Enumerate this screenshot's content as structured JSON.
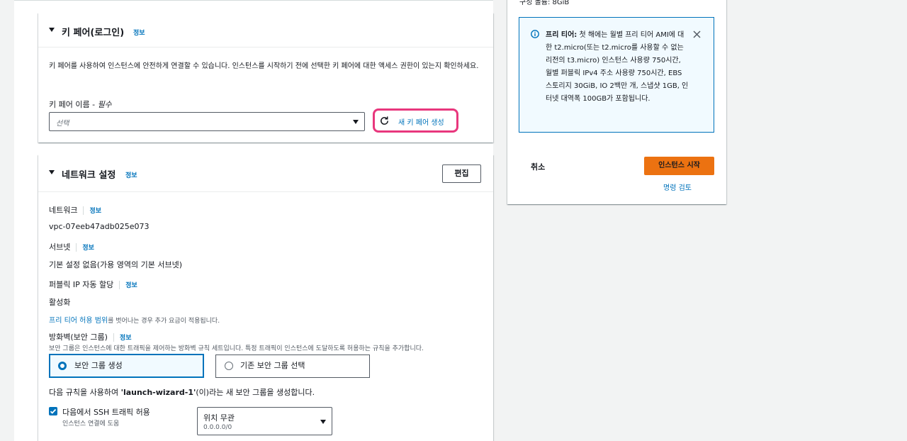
{
  "keypair": {
    "title": "키 페어(로그인)",
    "info": "정보",
    "description": "키 페어를 사용하여 인스턴스에 안전하게 연결할 수 있습니다. 인스턴스를 시작하기 전에 선택한 키 페어에 대한 액세스 권한이 있는지 확인하세요.",
    "field_label": "키 페어 이름 - ",
    "field_required": "필수",
    "select_placeholder": "선택",
    "create_button": "새 키 페어 생성"
  },
  "network": {
    "title": "네트워크 설정",
    "info": "정보",
    "edit_button": "편집",
    "network_label": "네트워크",
    "network_info": "정보",
    "network_value": "vpc-07eeb47adb025e073",
    "subnet_label": "서브넷",
    "subnet_info": "정보",
    "subnet_value": "기본 설정 없음(가용 영역의 기본 서브넷)",
    "public_ip_label": "퍼블릭 IP 자동 할당",
    "public_ip_info": "정보",
    "public_ip_value": "활성화",
    "free_tier_link": "프리 티어 허용 범위",
    "free_tier_note": "를 벗어나는 경우 추가 요금이 적용됩니다.",
    "firewall_label": "방화벽(보안 그룹)",
    "firewall_info": "정보",
    "firewall_desc": "보안 그룹은 인스턴스에 대한 트래픽을 제어하는 방화벽 규칙 세트입니다. 특정 트래픽이 인스턴스에 도달하도록 허용하는 규칙을 추가합니다.",
    "radio_create": "보안 그룹 생성",
    "radio_existing": "기존 보안 그룹 선택",
    "rule_sentence_pre": "다음 규칙을 사용하여 ",
    "rule_sentence_name": "'launch-wizard-1'",
    "rule_sentence_post": "(이)라는 새 보안 그룹을 생성합니다.",
    "ssh_label": "다음에서 SSH 트래픽 허용",
    "ssh_sub": "인스턴스 연결에 도움",
    "ssh_select_value": "위치 무관",
    "ssh_select_sub": "0.0.0.0/0"
  },
  "summary": {
    "top_text": "구성 볼륨: 8GiB",
    "alert_bold": "프리 티어:",
    "alert_text": " 첫 해에는 월별 프리 티어 AMI에 대한 t2.micro(또는 t2.micro를 사용할 수 없는 리전의 t3.micro) 인스턴스 사용량 750시간, 월별 퍼블릭 IPv4 주소 사용량 750시간, EBS 스토리지 30GiB, IO 2백만 개, 스냅샷 1GB, 인터넷 대역폭 100GB가 포함됩니다.",
    "cancel_button": "취소",
    "launch_button": "인스턴스 시작",
    "review_link": "명령 검토"
  },
  "colors": {
    "accent": "#0073bb",
    "launch": "#ec7211",
    "highlight": "#e8377d"
  }
}
